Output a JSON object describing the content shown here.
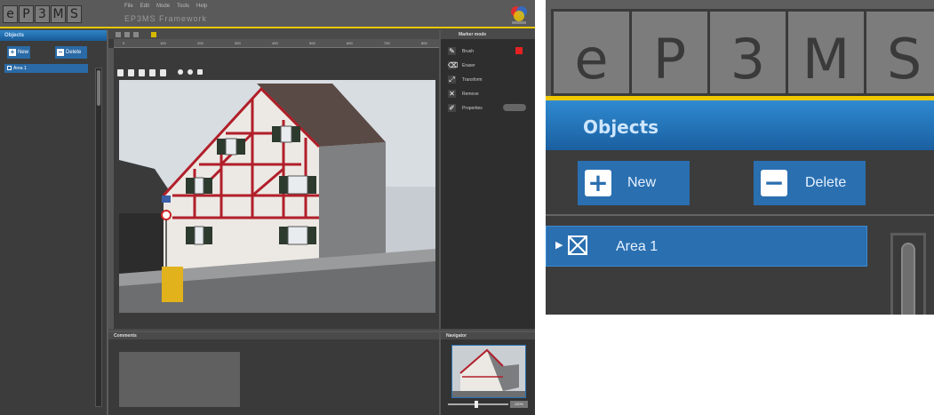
{
  "header": {
    "logo_letters": [
      "e",
      "P",
      "3",
      "M",
      "S"
    ],
    "menu": [
      "File",
      "Edit",
      "Mode",
      "Tools",
      "Help"
    ],
    "app_title": "EP3MS Framework",
    "brand_icon": "ep3ms-brand-icon"
  },
  "objects_panel": {
    "title": "Objects",
    "new_label": "New",
    "delete_label": "Delete",
    "items": [
      {
        "label": "Area 1",
        "icon": "area-box-icon"
      }
    ]
  },
  "modes_panel": {
    "title": "Marker mode",
    "rows": [
      {
        "label": "Brush",
        "icon": "brush-icon"
      },
      {
        "label": "Eraser",
        "icon": "eraser-icon"
      },
      {
        "label": "Transform",
        "icon": "transform-icon"
      },
      {
        "label": "Remove",
        "icon": "remove-icon"
      },
      {
        "label": "Properties",
        "icon": "properties-icon"
      }
    ],
    "brush_color": "#e32222"
  },
  "comments_panel": {
    "title": "Comments"
  },
  "navigator_panel": {
    "title": "Navigator",
    "zoom": "100%"
  },
  "ruler_ticks": [
    "0",
    "100",
    "200",
    "300",
    "400",
    "500",
    "600",
    "700",
    "800"
  ],
  "colors": {
    "accent_blue": "#2a6fb0",
    "header_yellow": "#f0c800",
    "panel_dark": "#3c3c3c"
  }
}
